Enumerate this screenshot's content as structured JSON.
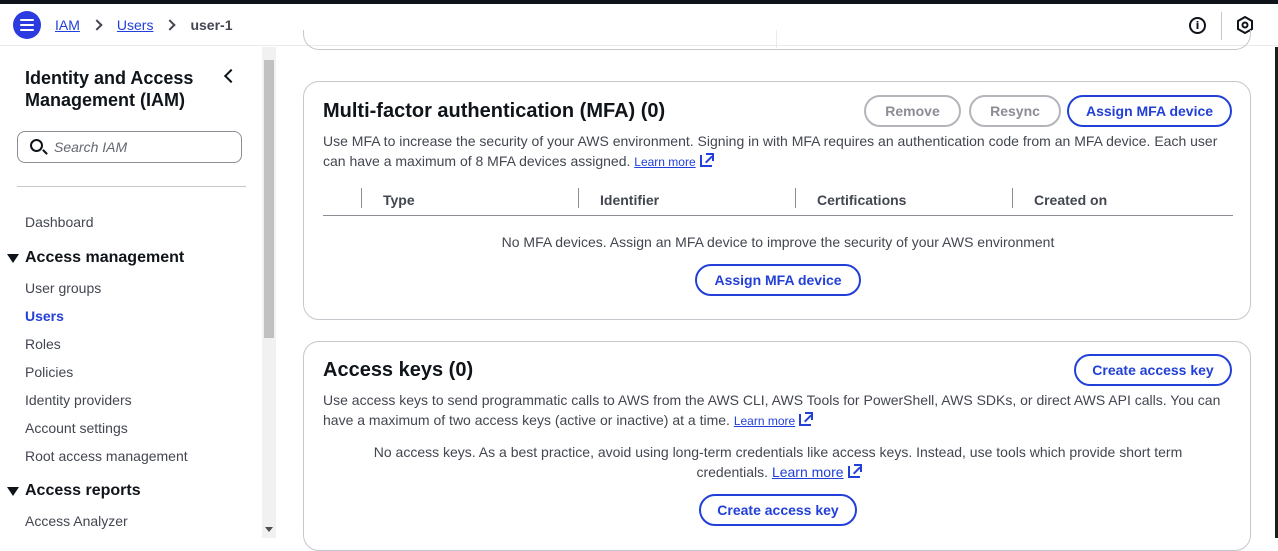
{
  "breadcrumb": {
    "items": [
      "IAM",
      "Users"
    ],
    "current": "user-1"
  },
  "sidebar": {
    "title": "Identity and Access Management (IAM)",
    "search_placeholder": "Search IAM",
    "dashboard": "Dashboard",
    "access_management": {
      "label": "Access management",
      "items": [
        "User groups",
        "Users",
        "Roles",
        "Policies",
        "Identity providers",
        "Account settings",
        "Root access management"
      ]
    },
    "access_reports": {
      "label": "Access reports",
      "items": [
        "Access Analyzer"
      ]
    }
  },
  "mfa": {
    "title": "Multi-factor authentication (MFA) (0)",
    "remove_label": "Remove",
    "resync_label": "Resync",
    "assign_label": "Assign MFA device",
    "description": "Use MFA to increase the security of your AWS environment. Signing in with MFA requires an authentication code from an MFA device. Each user can have a maximum of 8 MFA devices assigned.",
    "learn_more": "Learn more",
    "columns": [
      "Type",
      "Identifier",
      "Certifications",
      "Created on"
    ],
    "empty_text": "No MFA devices. Assign an MFA device to improve the security of your AWS environment",
    "empty_button": "Assign MFA device"
  },
  "access_keys": {
    "title": "Access keys (0)",
    "create_label": "Create access key",
    "description": "Use access keys to send programmatic calls to AWS from the AWS CLI, AWS Tools for PowerShell, AWS SDKs, or direct AWS API calls. You can have a maximum of two access keys (active or inactive) at a time.",
    "learn_more": "Learn more",
    "empty_text": "No access keys. As a best practice, avoid using long-term credentials like access keys. Instead, use tools which provide short term credentials.",
    "empty_learn_more": "Learn more",
    "empty_button": "Create access key"
  },
  "icons": {
    "menu": "hamburger-menu-icon",
    "info": "info-icon",
    "settings": "hexagon-settings-icon",
    "search": "search-icon",
    "external": "external-link-icon"
  },
  "colors": {
    "accent": "#2240d8",
    "menu_button": "#2b3be0",
    "text": "#0f141a",
    "border": "#c6c6cd"
  }
}
